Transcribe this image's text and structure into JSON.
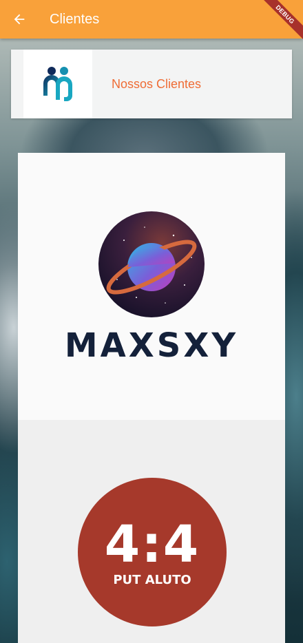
{
  "appbar": {
    "title": "Clientes",
    "back_icon": "arrow-left-icon",
    "color": "#f9a13a"
  },
  "debug_banner": "DEBUG",
  "header": {
    "label": "Nossos Clientes",
    "icon": "people-icon",
    "label_color": "#ef6c35"
  },
  "clients": [
    {
      "name": "MAXSXY",
      "logo": "planet-logo"
    },
    {
      "score": "4:4",
      "subtitle": "PUT ALUTO",
      "logo": "red-circle-logo",
      "color": "#a6392b"
    }
  ]
}
